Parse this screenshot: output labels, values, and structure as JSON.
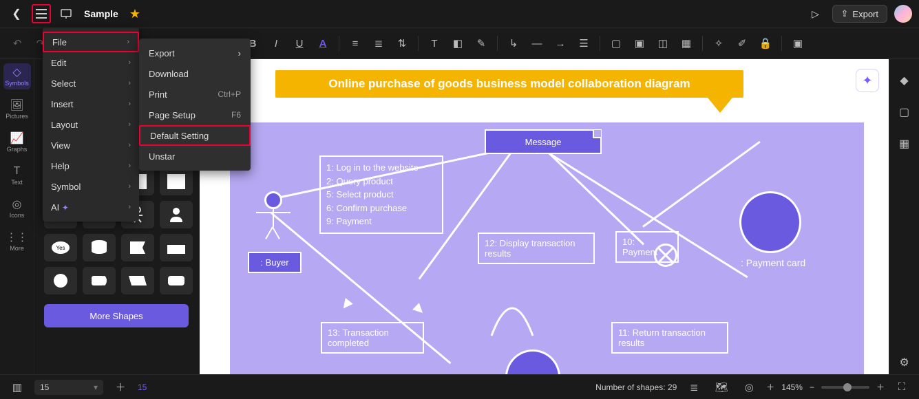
{
  "header": {
    "doc_title": "Sample",
    "export_label": "Export"
  },
  "main_menu": {
    "items": [
      {
        "label": "File",
        "has_sub": true,
        "highlight": true
      },
      {
        "label": "Edit",
        "has_sub": true
      },
      {
        "label": "Select",
        "has_sub": true
      },
      {
        "label": "Insert",
        "has_sub": true
      },
      {
        "label": "Layout",
        "has_sub": true
      },
      {
        "label": "View",
        "has_sub": true
      },
      {
        "label": "Help",
        "has_sub": true
      },
      {
        "label": "Symbol",
        "has_sub": true
      },
      {
        "label": "AI",
        "has_sub": true,
        "spark": true
      }
    ]
  },
  "file_submenu": {
    "items": [
      {
        "label": "Export",
        "has_sub": true
      },
      {
        "label": "Download"
      },
      {
        "label": "Print",
        "shortcut": "Ctrl+P"
      },
      {
        "label": "Page Setup",
        "shortcut": "F6"
      },
      {
        "label": "Default Setting",
        "highlight": true
      },
      {
        "label": "Unstar"
      }
    ]
  },
  "leftrail": {
    "items": [
      {
        "label": "Symbols",
        "active": true
      },
      {
        "label": "Pictures"
      },
      {
        "label": "Graphs"
      },
      {
        "label": "Text"
      },
      {
        "label": "Icons"
      },
      {
        "label": "More"
      }
    ]
  },
  "shapes": {
    "more_label": "More Shapes"
  },
  "diagram": {
    "title": "Online purchase of goods business model collaboration diagram",
    "message_box": "Message",
    "login_box": "1: Log in to the website\n2: Query product\n5: Select product\n6: Confirm purchase\n9: Payment",
    "buyer_label": ": Buyer",
    "tx12": "12: Display transaction results",
    "tx10": "10: Payment",
    "paycard": ": Payment card",
    "tx13": "13: Transaction completed",
    "tx11": "11: Return transaction results"
  },
  "statusbar": {
    "page": "15",
    "page2": "15",
    "shape_count_label": "Number of shapes:",
    "shape_count": "29",
    "zoom": "145%"
  }
}
